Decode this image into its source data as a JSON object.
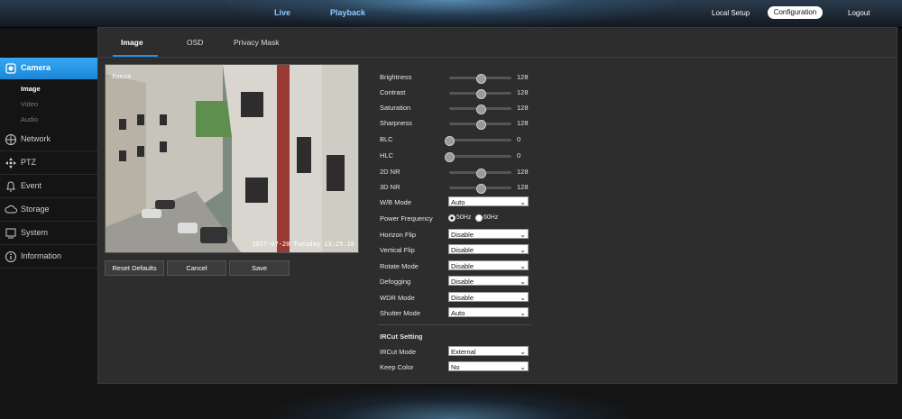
{
  "topbar": {
    "nav_live": "Live",
    "nav_playback": "Playback",
    "local_setup": "Local Setup",
    "configuration": "Configuration",
    "logout": "Logout"
  },
  "sidebar": {
    "items": [
      {
        "label": "Camera",
        "icon": "camera-icon"
      },
      {
        "label": "Network",
        "icon": "network-icon"
      },
      {
        "label": "PTZ",
        "icon": "ptz-icon"
      },
      {
        "label": "Event",
        "icon": "event-icon"
      },
      {
        "label": "Storage",
        "icon": "storage-icon"
      },
      {
        "label": "System",
        "icon": "system-icon"
      },
      {
        "label": "Information",
        "icon": "info-icon"
      }
    ],
    "sub_items": [
      "Image",
      "Video",
      "Audio"
    ]
  },
  "tabs": [
    "Image",
    "OSD",
    "Privacy Mask"
  ],
  "video": {
    "osd_top": "Xueza",
    "osd_bottom": "2017-07-20 Tuesday 13:25:28"
  },
  "buttons": {
    "reset": "Reset Defaults",
    "cancel": "Cancel",
    "save": "Save"
  },
  "sliders": [
    {
      "label": "Brightness",
      "value": 128,
      "fraction": 0.5
    },
    {
      "label": "Contrast",
      "value": 128,
      "fraction": 0.5
    },
    {
      "label": "Saturation",
      "value": 128,
      "fraction": 0.5
    },
    {
      "label": "Sharpness",
      "value": 128,
      "fraction": 0.5
    },
    {
      "label": "BLC",
      "value": 0,
      "fraction": 0
    },
    {
      "label": "HLC",
      "value": 0,
      "fraction": 0
    },
    {
      "label": "2D NR",
      "value": 128,
      "fraction": 0.5
    },
    {
      "label": "3D NR",
      "value": 128,
      "fraction": 0.5
    }
  ],
  "wb_mode": {
    "label": "W/B Mode",
    "value": "Auto"
  },
  "power_frequency": {
    "label": "Power Frequency",
    "option_50": "50Hz",
    "option_60": "60Hz",
    "selected": "50Hz"
  },
  "selects": [
    {
      "label": "Horizon Flip",
      "value": "Disable"
    },
    {
      "label": "Vertical Flip",
      "value": "Disable"
    },
    {
      "label": "Rotate Mode",
      "value": "Disable"
    },
    {
      "label": "Defogging",
      "value": "Disable"
    },
    {
      "label": "WDR Mode",
      "value": "Disable"
    },
    {
      "label": "Shutter Mode",
      "value": "Auto"
    }
  ],
  "ircut": {
    "heading": "IRCut Setting",
    "mode_label": "IRCut Mode",
    "mode_value": "External",
    "keep_color_label": "Keep Color",
    "keep_color_value": "No"
  },
  "colors": {
    "accent": "#2596e6",
    "panel": "#2d2d2d",
    "background": "#141414"
  }
}
